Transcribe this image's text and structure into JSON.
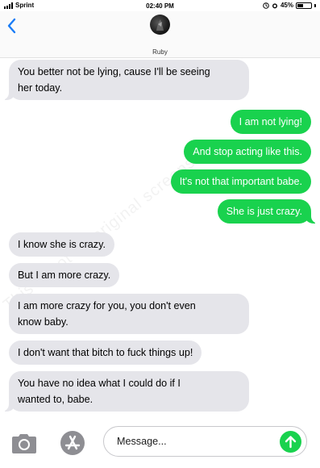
{
  "status_bar": {
    "carrier": "Sprint",
    "time": "02:40 PM",
    "battery": "45%",
    "battery_level": 0.45
  },
  "header": {
    "contact_name": "Ruby"
  },
  "messages": [
    {
      "direction": "in",
      "text_lines": [
        "You better not be lying, cause I'll be seeing",
        "her today."
      ]
    },
    {
      "direction": "out",
      "text_lines": [
        "I am not lying!"
      ]
    },
    {
      "direction": "out",
      "text_lines": [
        "And stop acting like this."
      ]
    },
    {
      "direction": "out",
      "text_lines": [
        "It's not that important babe."
      ]
    },
    {
      "direction": "out",
      "text_lines": [
        "She is just crazy."
      ]
    },
    {
      "direction": "in",
      "text_lines": [
        "I know she is crazy."
      ]
    },
    {
      "direction": "in",
      "text_lines": [
        "But I am more crazy."
      ]
    },
    {
      "direction": "in",
      "text_lines": [
        "I am more crazy for you, you don't even",
        "know baby."
      ]
    },
    {
      "direction": "in",
      "text_lines": [
        "I don't want that bitch to fuck things up!"
      ]
    },
    {
      "direction": "in",
      "text_lines": [
        "You have no idea what I could do if I",
        "wanted to, babe."
      ]
    }
  ],
  "input": {
    "placeholder": "Message..."
  },
  "watermark": "This is not an original screenshot",
  "colors": {
    "outgoing_bubble": "#19d24e",
    "incoming_bubble": "#e5e5ea",
    "accent": "#1a7cf6"
  },
  "icons": [
    "back-chevron-icon",
    "camera-icon",
    "app-store-icon",
    "send-arrow-icon",
    "signal-bars-icon",
    "battery-icon",
    "alarm-icon",
    "location-icon"
  ]
}
